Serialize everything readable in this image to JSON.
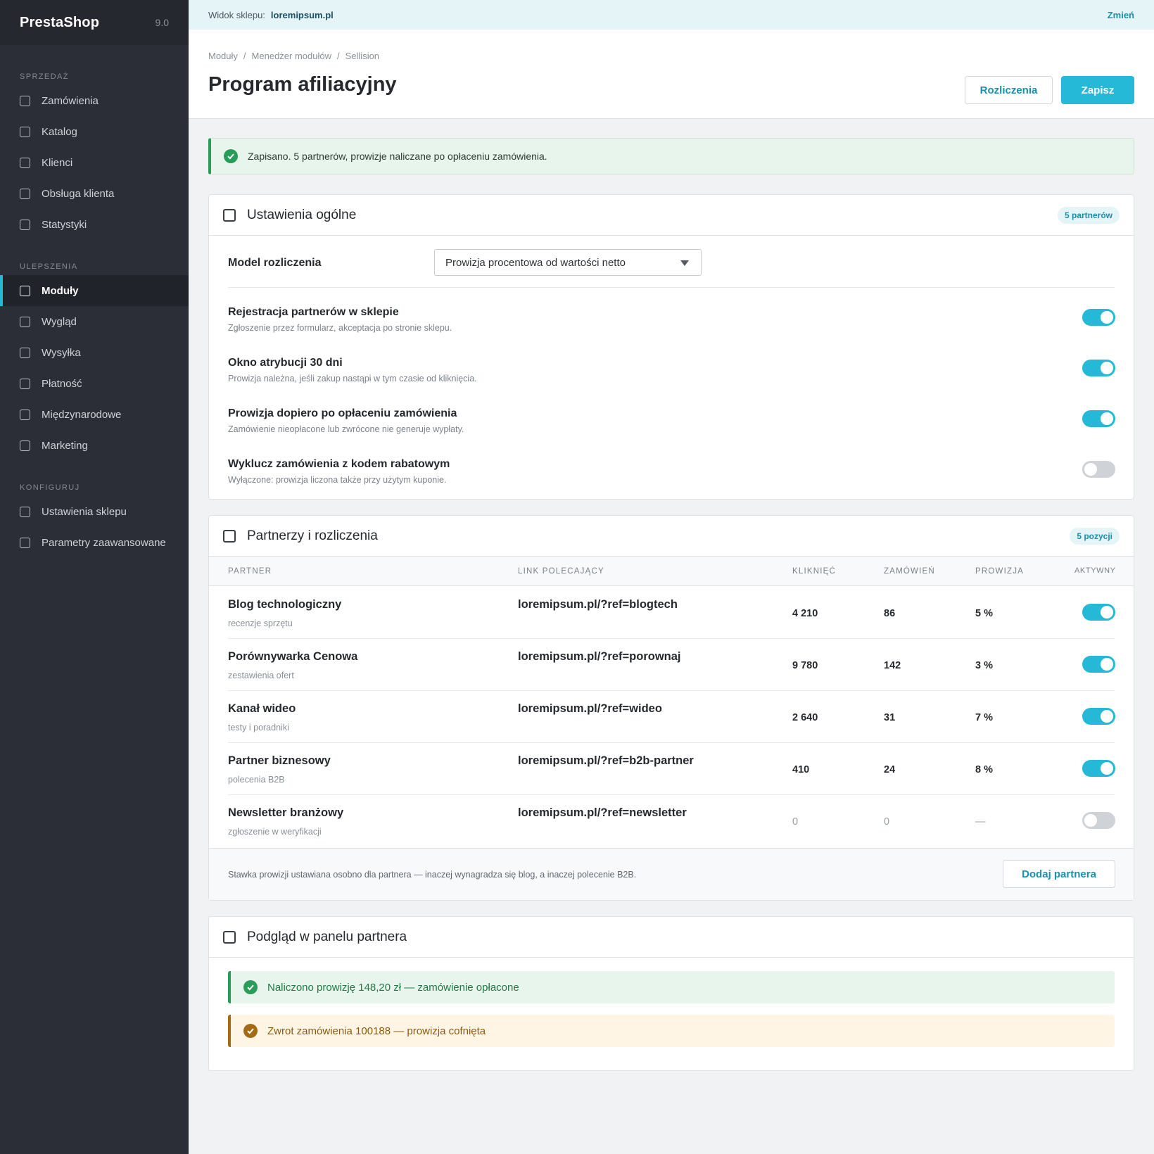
{
  "brand": {
    "name": "PrestaShop",
    "version": "9.0"
  },
  "sidebar": {
    "sections": [
      {
        "title": "SPRZEDAŻ",
        "items": [
          "Zamówienia",
          "Katalog",
          "Klienci",
          "Obsługa klienta",
          "Statystyki"
        ]
      },
      {
        "title": "ULEPSZENIA",
        "items": [
          "Moduły",
          "Wygląd",
          "Wysyłka",
          "Płatność",
          "Międzynarodowe",
          "Marketing"
        ]
      },
      {
        "title": "KONFIGURUJ",
        "items": [
          "Ustawienia sklepu",
          "Parametry zaawansowane"
        ]
      }
    ],
    "active": "Moduły"
  },
  "topbar": {
    "label": "Widok sklepu:",
    "shop": "loremipsum.pl",
    "change": "Zmień"
  },
  "header": {
    "breadcrumb": [
      "Moduły",
      "Menedżer modułów",
      "Sellision"
    ],
    "title": "Program afiliacyjny",
    "btn_settlements": "Rozliczenia",
    "btn_save": "Zapisz"
  },
  "alert": {
    "text": "Zapisano. 5 partnerów, prowizje naliczane po opłaceniu zamówienia."
  },
  "general": {
    "title": "Ustawienia ogólne",
    "badge": "5 partnerów",
    "model_label": "Model rozliczenia",
    "model_value": "Prowizja procentowa od wartości netto",
    "options": [
      {
        "title": "Rejestracja partnerów w sklepie",
        "desc": "Zgłoszenie przez formularz, akceptacja po stronie sklepu.",
        "on": true
      },
      {
        "title": "Okno atrybucji 30 dni",
        "desc": "Prowizja należna, jeśli zakup nastąpi w tym czasie od kliknięcia.",
        "on": true
      },
      {
        "title": "Prowizja dopiero po opłaceniu zamówienia",
        "desc": "Zamówienie nieopłacone lub zwrócone nie generuje wypłaty.",
        "on": true
      },
      {
        "title": "Wyklucz zamówienia z kodem rabatowym",
        "desc": "Wyłączone: prowizja liczona także przy użytym kuponie.",
        "on": false
      }
    ]
  },
  "partners": {
    "title": "Partnerzy i rozliczenia",
    "badge": "5 pozycji",
    "columns": {
      "partner": "PARTNER",
      "link": "LINK POLECAJĄCY",
      "clicks": "KLIKNIĘĆ",
      "orders": "ZAMÓWIEŃ",
      "commission": "PROWIZJA",
      "active": "AKTYWNY"
    },
    "rows": [
      {
        "name": "Blog technologiczny",
        "sub": "recenzje sprzętu",
        "link": "loremipsum.pl/?ref=blogtech",
        "clicks": "4 210",
        "orders": "86",
        "commission": "5 %",
        "active": true
      },
      {
        "name": "Porównywarka Cenowa",
        "sub": "zestawienia ofert",
        "link": "loremipsum.pl/?ref=porownaj",
        "clicks": "9 780",
        "orders": "142",
        "commission": "3 %",
        "active": true
      },
      {
        "name": "Kanał wideo",
        "sub": "testy i poradniki",
        "link": "loremipsum.pl/?ref=wideo",
        "clicks": "2 640",
        "orders": "31",
        "commission": "7 %",
        "active": true
      },
      {
        "name": "Partner biznesowy",
        "sub": "polecenia B2B",
        "link": "loremipsum.pl/?ref=b2b-partner",
        "clicks": "410",
        "orders": "24",
        "commission": "8 %",
        "active": true
      },
      {
        "name": "Newsletter branżowy",
        "sub": "zgłoszenie w weryfikacji",
        "link": "loremipsum.pl/?ref=newsletter",
        "clicks": "0",
        "orders": "0",
        "commission": "—",
        "active": false
      }
    ],
    "footer_note": "Stawka prowizji ustawiana osobno dla partnera — inaczej wynagradza się blog, a inaczej polecenie B2B.",
    "add_button": "Dodaj partnera"
  },
  "preview": {
    "title": "Podgląd w panelu partnera",
    "ok": "Naliczono prowizję 148,20 zł — zamówienie opłacone",
    "warn": "Zwrot zamówienia 100188 — prowizja cofnięta"
  },
  "colors": {
    "accent": "#25b9d7",
    "sidebar": "#2b2e36",
    "success": "#2a9c5a",
    "warning": "#a46b16"
  }
}
